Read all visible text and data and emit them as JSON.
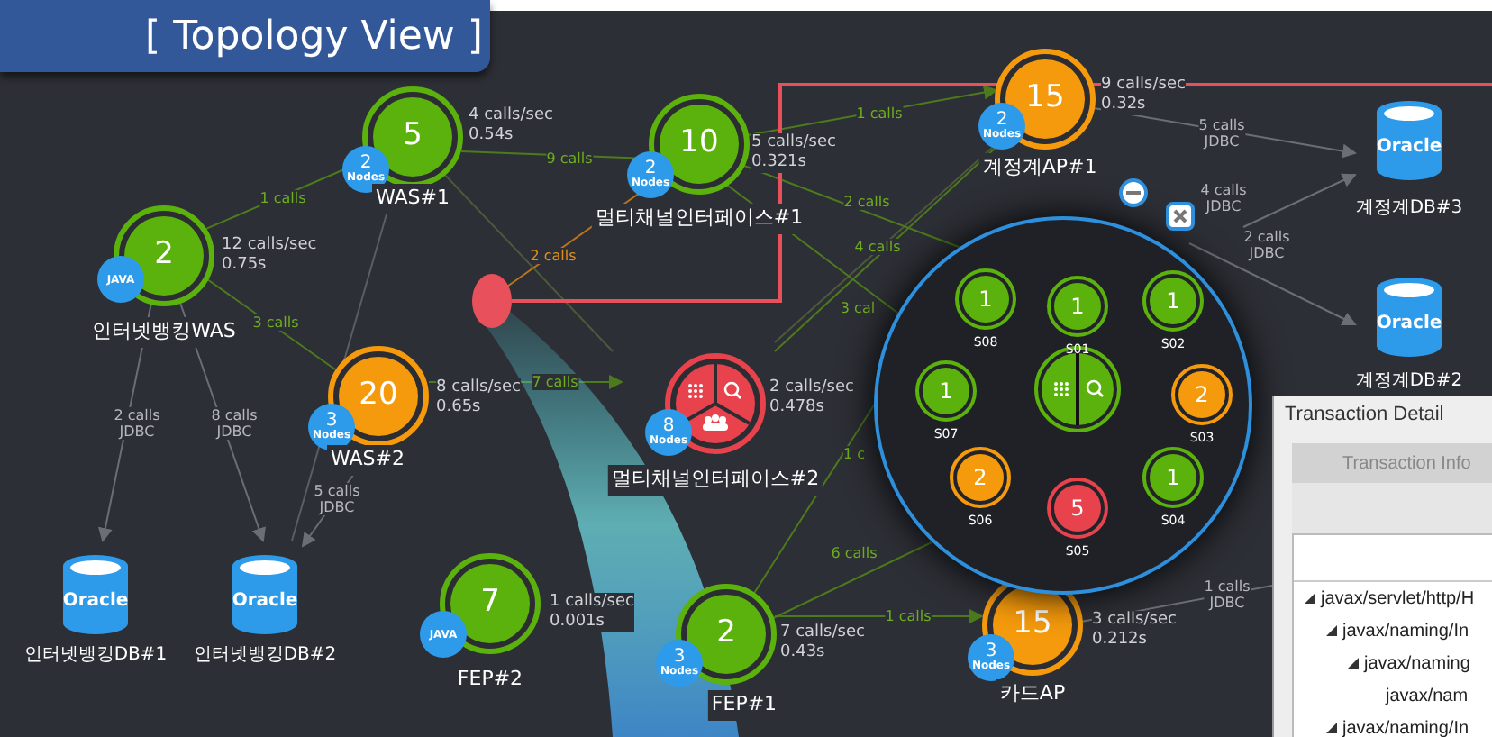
{
  "banner": {
    "title": "[ Topology View ]"
  },
  "nodes": [
    {
      "label": "인터넷뱅킹WAS",
      "count": "2",
      "color": "#5cb20c",
      "kind": "simple",
      "badge": {
        "kind": "platform",
        "text": "JAVA"
      },
      "stats": [
        "12 calls/sec",
        "0.75s"
      ]
    },
    {
      "label": "WAS#1",
      "count": "5",
      "color": "#5cb20c",
      "kind": "simple",
      "badge": {
        "kind": "nodes",
        "count": "2",
        "unit": "Nodes"
      },
      "stats": [
        "4 calls/sec",
        "0.54s"
      ]
    },
    {
      "label": "멀티채널인터페이스#1",
      "count": "10",
      "color": "#5cb20c",
      "kind": "simple",
      "badge": {
        "kind": "nodes",
        "count": "2",
        "unit": "Nodes"
      },
      "stats": [
        "5 calls/sec",
        "0.321s"
      ]
    },
    {
      "label": "계정계AP#1",
      "count": "15",
      "color": "#f59a0c",
      "kind": "simple",
      "badge": {
        "kind": "nodes",
        "count": "2",
        "unit": "Nodes"
      },
      "stats": [
        "9 calls/sec",
        "0.32s"
      ]
    },
    {
      "label": "WAS#2",
      "count": "20",
      "color": "#f59a0c",
      "kind": "simple",
      "badge": {
        "kind": "nodes",
        "count": "3",
        "unit": "Nodes"
      },
      "stats": [
        "8 calls/sec",
        "0.65s"
      ]
    },
    {
      "label": "멀티채널인터페이스#2",
      "color": "#e8424c",
      "kind": "segmented",
      "badge": {
        "kind": "nodes",
        "count": "8",
        "unit": "Nodes"
      },
      "stats": [
        "2 calls/sec",
        "0.478s"
      ]
    },
    {
      "label": "FEP#2",
      "count": "7",
      "color": "#5cb20c",
      "kind": "simple",
      "badge": {
        "kind": "platform",
        "text": "JAVA"
      },
      "stats": [
        "1 calls/sec",
        "0.001s"
      ]
    },
    {
      "label": "FEP#1",
      "count": "2",
      "color": "#5cb20c",
      "kind": "simple",
      "badge": {
        "kind": "nodes",
        "count": "3",
        "unit": "Nodes"
      },
      "stats": [
        "7 calls/sec",
        "0.43s"
      ]
    },
    {
      "label": "카드AP",
      "count": "15",
      "color": "#f59a0c",
      "kind": "simple",
      "badge": {
        "kind": "nodes",
        "count": "3",
        "unit": "Nodes"
      },
      "stats": [
        "3 calls/sec",
        "0.212s"
      ]
    }
  ],
  "edges": [
    {
      "kind": "call",
      "lines": [
        "1 calls"
      ]
    },
    {
      "kind": "call",
      "lines": [
        "9 calls"
      ]
    },
    {
      "kind": "call",
      "lines": [
        "3 calls"
      ]
    },
    {
      "kind": "alert",
      "lines": [
        "2 calls"
      ]
    },
    {
      "kind": "call",
      "lines": [
        "7 calls"
      ]
    },
    {
      "kind": "call",
      "lines": [
        "1 calls"
      ]
    },
    {
      "kind": "call",
      "lines": [
        "2 calls"
      ]
    },
    {
      "kind": "call",
      "lines": [
        "4 calls"
      ]
    },
    {
      "kind": "call",
      "lines": [
        "3 cal"
      ]
    },
    {
      "kind": "call",
      "lines": [
        "1 c"
      ]
    },
    {
      "kind": "call",
      "lines": [
        "6 calls"
      ]
    },
    {
      "kind": "call",
      "lines": [
        "1 calls"
      ]
    },
    {
      "kind": "jdbc",
      "lines": [
        "2 calls",
        "JDBC"
      ]
    },
    {
      "kind": "jdbc",
      "lines": [
        "8 calls",
        "JDBC"
      ]
    },
    {
      "kind": "jdbc",
      "lines": [
        "5 calls",
        "JDBC"
      ]
    },
    {
      "kind": "jdbc",
      "lines": [
        "5 calls",
        "JDBC"
      ]
    },
    {
      "kind": "jdbc",
      "lines": [
        "4 calls",
        "JDBC"
      ]
    },
    {
      "kind": "jdbc",
      "lines": [
        "2 calls",
        "JDBC"
      ]
    },
    {
      "kind": "jdbc",
      "lines": [
        "1 calls",
        "JDBC"
      ]
    }
  ],
  "databases": [
    {
      "name": "인터넷뱅킹DB#1",
      "logo": "Oracle"
    },
    {
      "name": "인터넷뱅킹DB#2",
      "logo": "Oracle"
    },
    {
      "name": "계정계DB#3",
      "logo": "Oracle"
    },
    {
      "name": "계정계DB#2",
      "logo": "Oracle"
    }
  ],
  "cluster": {
    "members": [
      {
        "name": "S01",
        "count": "1",
        "color": "#5cb20c"
      },
      {
        "name": "S02",
        "count": "1",
        "color": "#5cb20c"
      },
      {
        "name": "S03",
        "count": "2",
        "color": "#f59a0c"
      },
      {
        "name": "S04",
        "count": "1",
        "color": "#5cb20c"
      },
      {
        "name": "S05",
        "count": "5",
        "color": "#e8424c"
      },
      {
        "name": "S06",
        "count": "2",
        "color": "#f59a0c"
      },
      {
        "name": "S07",
        "count": "1",
        "color": "#5cb20c"
      },
      {
        "name": "S08",
        "count": "1",
        "color": "#5cb20c"
      }
    ]
  },
  "transaction_detail": {
    "title": "Transaction Detail",
    "tabs": [
      {
        "label": "Transaction Info",
        "selected": false
      }
    ],
    "tree": [
      {
        "text": "javax/servlet/http/H",
        "expanded": true,
        "children": [
          {
            "text": "javax/naming/In",
            "expanded": true,
            "children": [
              {
                "text": "javax/naming",
                "expanded": true,
                "children": [
                  {
                    "text": "javax/nam"
                  }
                ]
              }
            ]
          },
          {
            "text": "javax/naming/In",
            "expanded": true
          }
        ]
      }
    ]
  }
}
